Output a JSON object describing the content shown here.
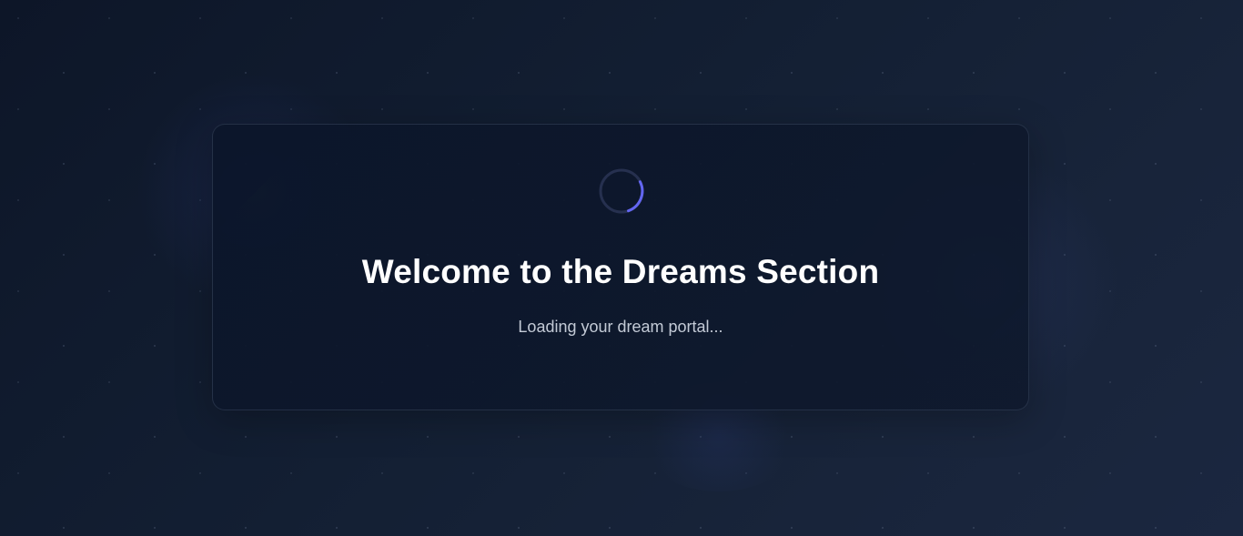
{
  "loader": {
    "title": "Welcome to the Dreams Section",
    "subtitle": "Loading your dream portal...",
    "spinner_icon": "loading-spinner-icon"
  },
  "colors": {
    "background": "#131f33",
    "card_background": "#0f192d",
    "spinner_track": "#26304f",
    "spinner_accent": "#6366f1",
    "title_text": "#ffffff",
    "subtitle_text": "#c3cad6"
  }
}
